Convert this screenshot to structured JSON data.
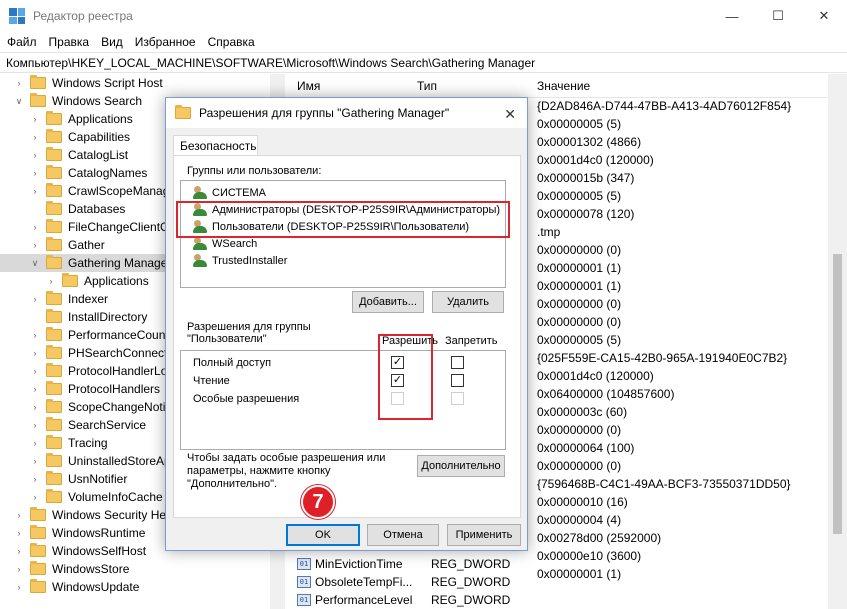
{
  "window": {
    "title": "Редактор реестра",
    "buttons": [
      "—",
      "☐",
      "✕"
    ]
  },
  "menu": [
    "Файл",
    "Правка",
    "Вид",
    "Избранное",
    "Справка"
  ],
  "address": "Компьютер\\HKEY_LOCAL_MACHINE\\SOFTWARE\\Microsoft\\Windows Search\\Gathering Manager",
  "tree": [
    {
      "label": "Windows Script Host",
      "indent": 0,
      "chev": ">"
    },
    {
      "label": "Windows Search",
      "indent": 0,
      "chev": "v"
    },
    {
      "label": "Applications",
      "indent": 1,
      "chev": ">"
    },
    {
      "label": "Capabilities",
      "indent": 1,
      "chev": ">"
    },
    {
      "label": "CatalogList",
      "indent": 1,
      "chev": ">"
    },
    {
      "label": "CatalogNames",
      "indent": 1,
      "chev": ">"
    },
    {
      "label": "CrawlScopeManage",
      "indent": 1,
      "chev": ">"
    },
    {
      "label": "Databases",
      "indent": 1,
      "chev": ""
    },
    {
      "label": "FileChangeClientCo",
      "indent": 1,
      "chev": ">"
    },
    {
      "label": "Gather",
      "indent": 1,
      "chev": ">"
    },
    {
      "label": "Gathering Manager",
      "indent": 1,
      "chev": "v",
      "selected": true
    },
    {
      "label": "Applications",
      "indent": 2,
      "chev": ">"
    },
    {
      "label": "Indexer",
      "indent": 1,
      "chev": ">"
    },
    {
      "label": "InstallDirectory",
      "indent": 1,
      "chev": ""
    },
    {
      "label": "PerformanceCount",
      "indent": 1,
      "chev": ">"
    },
    {
      "label": "PHSearchConnecto",
      "indent": 1,
      "chev": ">"
    },
    {
      "label": "ProtocolHandlerLo",
      "indent": 1,
      "chev": ">"
    },
    {
      "label": "ProtocolHandlers",
      "indent": 1,
      "chev": ">"
    },
    {
      "label": "ScopeChangeNotif",
      "indent": 1,
      "chev": ">"
    },
    {
      "label": "SearchService",
      "indent": 1,
      "chev": ">"
    },
    {
      "label": "Tracing",
      "indent": 1,
      "chev": ">"
    },
    {
      "label": "UninstalledStoreAp",
      "indent": 1,
      "chev": ">"
    },
    {
      "label": "UsnNotifier",
      "indent": 1,
      "chev": ">"
    },
    {
      "label": "VolumeInfoCache",
      "indent": 1,
      "chev": ">"
    },
    {
      "label": "Windows Security Hea",
      "indent": 0,
      "chev": ">"
    },
    {
      "label": "WindowsRuntime",
      "indent": 0,
      "chev": ">"
    },
    {
      "label": "WindowsSelfHost",
      "indent": 0,
      "chev": ">"
    },
    {
      "label": "WindowsStore",
      "indent": 0,
      "chev": ">"
    },
    {
      "label": "WindowsUpdate",
      "indent": 0,
      "chev": ">"
    }
  ],
  "list": {
    "headers": {
      "name": "Имя",
      "type": "Тип",
      "value": "Значение"
    },
    "values": [
      "{D2AD846A-D744-47BB-A413-4AD76012F854}",
      "0x00000005 (5)",
      "0x00001302 (4866)",
      "0x0001d4c0 (120000)",
      "0x0000015b (347)",
      "0x00000005 (5)",
      "0x00000078 (120)",
      ".tmp",
      "0x00000000 (0)",
      "0x00000001 (1)",
      "0x00000001 (1)",
      "0x00000000 (0)",
      "0x00000000 (0)",
      "0x00000005 (5)",
      "{025F559E-CA15-42B0-965A-191940E0C7B2}",
      "0x0001d4c0 (120000)",
      "0x06400000 (104857600)",
      "0x0000003c (60)",
      "0x00000000 (0)",
      "0x00000064 (100)",
      "0x00000000 (0)",
      "{7596468B-C4C1-49AA-BCF3-73550371DD50}",
      "0x00000010 (16)",
      "0x00000004 (4)",
      "0x00278d00 (2592000)",
      "0x00000e10 (3600)",
      "0x00000001 (1)"
    ],
    "bottom_rows": [
      {
        "name": "MinEvictionTime",
        "type": "REG_DWORD"
      },
      {
        "name": "ObsoleteTempFi...",
        "type": "REG_DWORD"
      },
      {
        "name": "PerformanceLevel",
        "type": "REG_DWORD"
      }
    ]
  },
  "dialog": {
    "title": "Разрешения для группы \"Gathering Manager\"",
    "tab": "Безопасность",
    "groups_label": "Группы или пользователи:",
    "users": [
      "СИСТЕМА",
      "Администраторы (DESKTOP-P25S9IR\\Администраторы)",
      "Пользователи (DESKTOP-P25S9IR\\Пользователи)",
      "WSearch",
      "TrustedInstaller"
    ],
    "add_button": "Добавить...",
    "remove_button": "Удалить",
    "perm_label_line1": "Разрешения для группы",
    "perm_label_line2": "\"Пользователи\"",
    "allow_header": "Разрешить",
    "deny_header": "Запретить",
    "permissions": [
      {
        "name": "Полный доступ",
        "allow": true,
        "deny": false,
        "disabled": false
      },
      {
        "name": "Чтение",
        "allow": true,
        "deny": false,
        "disabled": false
      },
      {
        "name": "Особые разрешения",
        "allow": false,
        "deny": false,
        "disabled": true
      }
    ],
    "advanced_text_line1": "Чтобы задать особые разрешения или",
    "advanced_text_line2": "параметры, нажмите кнопку",
    "advanced_text_line3": "\"Дополнительно\".",
    "advanced_button": "Дополнительно",
    "ok_button": "OK",
    "cancel_button": "Отмена",
    "apply_button": "Применить"
  },
  "step_badge": "7",
  "colors": {
    "highlight": "#d9262f",
    "badge": "#e02027",
    "focus": "#0078d7"
  }
}
